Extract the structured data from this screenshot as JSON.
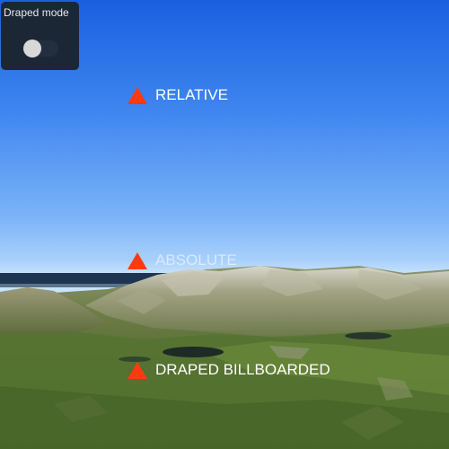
{
  "panel": {
    "title": "Draped mode",
    "toggle_state": "off"
  },
  "markers": {
    "relative": {
      "label": "RELATIVE",
      "icon": "red-triangle-icon",
      "color": "#ff3a10"
    },
    "absolute": {
      "label": "ABSOLUTE",
      "icon": "red-triangle-icon",
      "color": "#ff3a10"
    },
    "draped": {
      "label": "DRAPED BILLBOARDED",
      "icon": "red-triangle-icon",
      "color": "#ff3a10"
    }
  },
  "colors": {
    "sky_top": "#1a5fe0",
    "sky_horizon": "#c6e2fd",
    "sea": "#1e3552",
    "panel_bg": "#1c2736"
  }
}
